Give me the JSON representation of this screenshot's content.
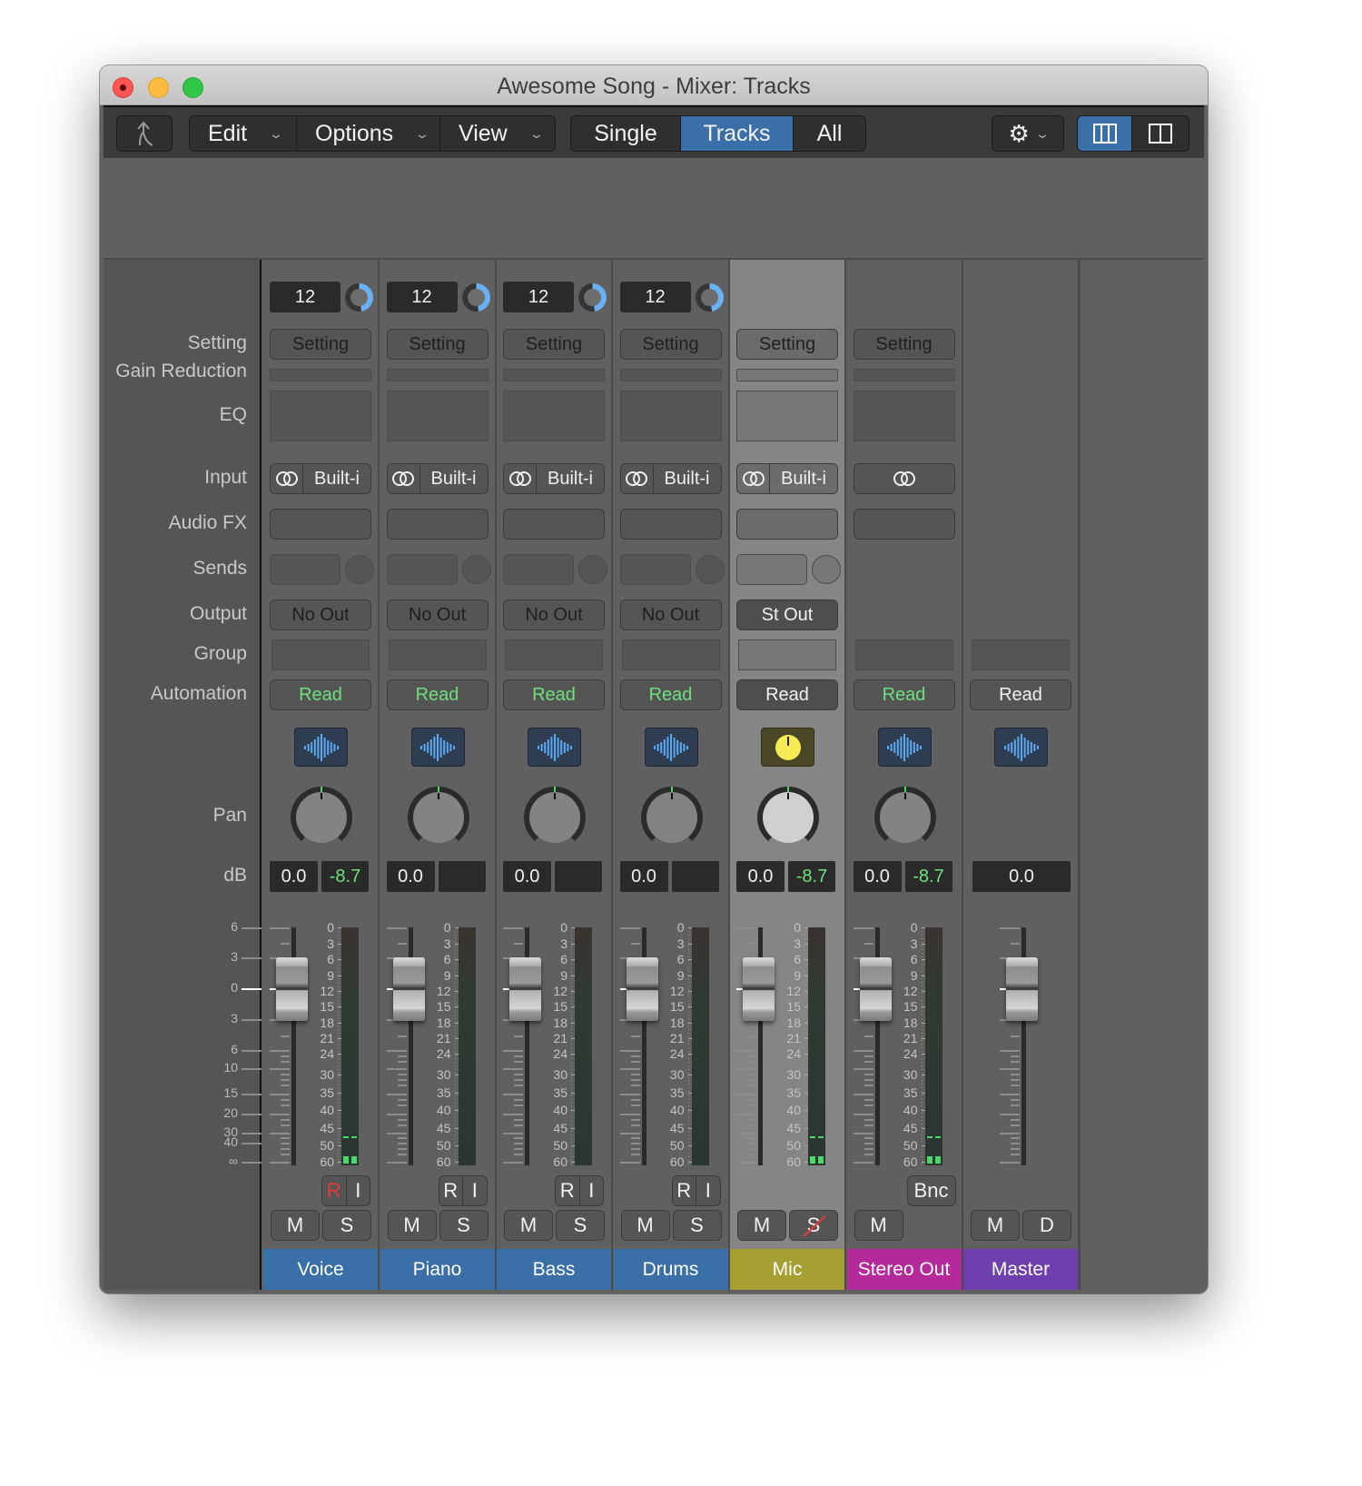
{
  "window": {
    "title": "Awesome Song - Mixer: Tracks"
  },
  "toolbar": {
    "back_icon": "arrow-up-left-icon",
    "menus": [
      {
        "label": "Edit"
      },
      {
        "label": "Options"
      },
      {
        "label": "View"
      }
    ],
    "view_modes": [
      {
        "label": "Single",
        "active": false
      },
      {
        "label": "Tracks",
        "active": true
      },
      {
        "label": "All",
        "active": false
      }
    ],
    "gear_icon": "gear-icon",
    "layout_buttons": [
      {
        "icon": "three-column-icon",
        "active": true
      },
      {
        "icon": "two-column-icon",
        "active": false
      }
    ]
  },
  "row_labels": {
    "setting": "Setting",
    "gain_reduction": "Gain Reduction",
    "eq": "EQ",
    "input": "Input",
    "audio_fx": "Audio FX",
    "sends": "Sends",
    "output": "Output",
    "group": "Group",
    "automation": "Automation",
    "pan": "Pan",
    "db": "dB"
  },
  "fader_scale": [
    "6",
    "3",
    "0",
    "3",
    "6",
    "10",
    "15",
    "20",
    "30",
    "40",
    "∞"
  ],
  "meter_scale": [
    "0",
    "3",
    "6",
    "9",
    "12",
    "15",
    "18",
    "21",
    "24",
    "30",
    "35",
    "40",
    "45",
    "50",
    "60"
  ],
  "colors": {
    "audio": "#3a6fa8",
    "mic": "#a6a032",
    "stereo_out": "#b52a9a",
    "master": "#6f3fae",
    "read_green": "#6de07d",
    "accent_blue": "#6ab0f5",
    "record_red": "#e33a3a"
  },
  "strips": [
    {
      "name": "Voice",
      "compressor": "12",
      "setting": "Setting",
      "input": "Built-i",
      "output": "No Out",
      "automation": "Read",
      "auto_green": true,
      "volume": "0.0",
      "peak": "-8.7",
      "record": "R",
      "input_mon": "I",
      "record_armed": true,
      "mute": "M",
      "solo": "S",
      "meter_active": true
    },
    {
      "name": "Piano",
      "compressor": "12",
      "setting": "Setting",
      "input": "Built-i",
      "output": "No Out",
      "automation": "Read",
      "auto_green": true,
      "volume": "0.0",
      "peak": "",
      "record": "R",
      "input_mon": "I",
      "mute": "M",
      "solo": "S"
    },
    {
      "name": "Bass",
      "compressor": "12",
      "setting": "Setting",
      "input": "Built-i",
      "output": "No Out",
      "automation": "Read",
      "auto_green": true,
      "volume": "0.0",
      "peak": "",
      "record": "R",
      "input_mon": "I",
      "mute": "M",
      "solo": "S"
    },
    {
      "name": "Drums",
      "compressor": "12",
      "setting": "Setting",
      "input": "Built-i",
      "output": "No Out",
      "automation": "Read",
      "auto_green": true,
      "volume": "0.0",
      "peak": "",
      "record": "R",
      "input_mon": "I",
      "mute": "M",
      "solo": "S"
    },
    {
      "name": "Mic",
      "setting": "Setting",
      "input": "Built-i",
      "output": "St Out",
      "automation": "Read",
      "auto_green": false,
      "volume": "0.0",
      "peak": "-8.7",
      "mute": "M",
      "solo": "S",
      "solo_disabled": true,
      "selected": true,
      "meter_active": true
    },
    {
      "name": "Stereo Out",
      "setting": "Setting",
      "input": "",
      "output": "",
      "automation": "Read",
      "auto_green": true,
      "volume": "0.0",
      "peak": "-8.7",
      "bounce": "Bnc",
      "mute": "M",
      "meter_active": true
    },
    {
      "name": "Master",
      "automation": "Read",
      "auto_green": false,
      "volume": "0.0",
      "mute": "M",
      "dim": "D"
    }
  ]
}
